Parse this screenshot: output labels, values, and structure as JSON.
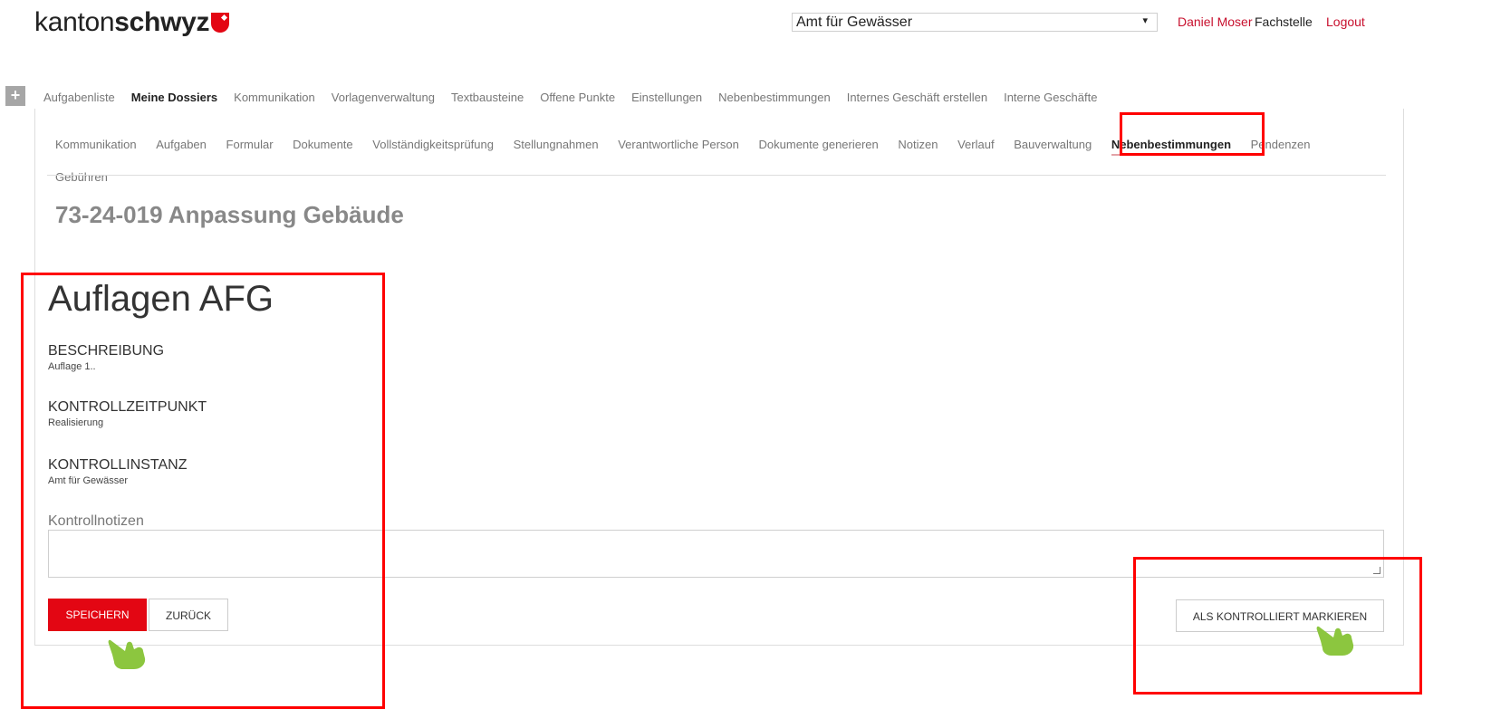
{
  "header": {
    "logo_light": "kanton",
    "logo_bold": "schwyz",
    "org_select_value": "Amt für Gewässer",
    "user_name": "Daniel Moser",
    "user_role": "Fachstelle",
    "logout_label": "Logout"
  },
  "main_nav": {
    "items": [
      {
        "label": "Aufgabenliste"
      },
      {
        "label": "Meine Dossiers"
      },
      {
        "label": "Kommunikation"
      },
      {
        "label": "Vorlagenverwaltung"
      },
      {
        "label": "Textbausteine"
      },
      {
        "label": "Offene Punkte"
      },
      {
        "label": "Einstellungen"
      },
      {
        "label": "Nebenbestimmungen"
      },
      {
        "label": "Internes Geschäft erstellen"
      },
      {
        "label": "Interne Geschäfte"
      }
    ],
    "active_index": 1
  },
  "sub_nav": {
    "items": [
      {
        "label": "Kommunikation"
      },
      {
        "label": "Aufgaben"
      },
      {
        "label": "Formular"
      },
      {
        "label": "Dokumente"
      },
      {
        "label": "Vollständigkeitsprüfung"
      },
      {
        "label": "Stellungnahmen"
      },
      {
        "label": "Verantwortliche Person"
      },
      {
        "label": "Dokumente generieren"
      },
      {
        "label": "Notizen"
      },
      {
        "label": "Verlauf"
      },
      {
        "label": "Bauverwaltung"
      },
      {
        "label": "Nebenbestimmungen"
      },
      {
        "label": "Pendenzen"
      },
      {
        "label": "Gebühren"
      }
    ],
    "active_index": 11
  },
  "dossier": {
    "title": "73-24-019 Anpassung Gebäude"
  },
  "detail": {
    "section_title": "Auflagen AFG",
    "description_label": "BESCHREIBUNG",
    "description_value": "Auflage 1..",
    "control_time_label": "KONTROLLZEITPUNKT",
    "control_time_value": "Realisierung",
    "control_instance_label": "KONTROLLINSTANZ",
    "control_instance_value": "Amt für Gewässer",
    "notes_label": "Kontrollnotizen",
    "notes_value": ""
  },
  "actions": {
    "save_label": "SPEICHERN",
    "back_label": "ZURÜCK",
    "mark_controlled_label": "ALS KONTROLLIERT MARKIEREN"
  },
  "colors": {
    "brand_red": "#e30613",
    "highlight_red": "#ff0000",
    "hand_green": "#8cc63f"
  },
  "icons": {
    "plus": "plus-icon",
    "select_caret": "caret-down-icon",
    "resize": "resize-grip-icon",
    "pointer": "pointing-hand-icon"
  }
}
